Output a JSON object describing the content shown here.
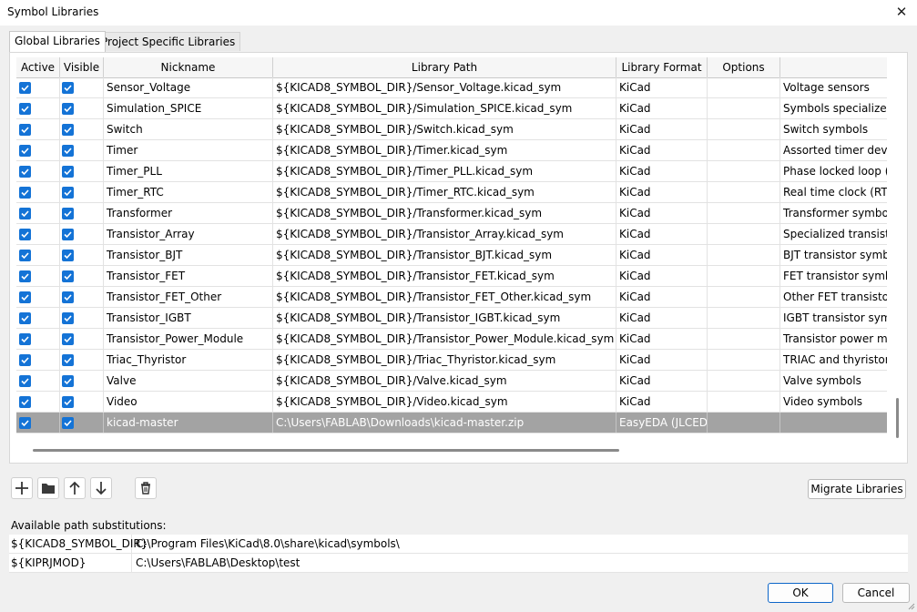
{
  "window": {
    "title": "Symbol Libraries",
    "close_glyph": "✕"
  },
  "tabs": [
    {
      "label": "Global Libraries",
      "active": true
    },
    {
      "label": "Project Specific Libraries",
      "active": false
    }
  ],
  "columns": [
    "Active",
    "Visible",
    "Nickname",
    "Library Path",
    "Library Format",
    "Options",
    ""
  ],
  "rows": [
    {
      "active": true,
      "visible": true,
      "nickname": "Sensor_Voltage",
      "path": "${KICAD8_SYMBOL_DIR}/Sensor_Voltage.kicad_sym",
      "format": "KiCad",
      "options": "",
      "description": "Voltage sensors"
    },
    {
      "active": true,
      "visible": true,
      "nickname": "Simulation_SPICE",
      "path": "${KICAD8_SYMBOL_DIR}/Simulation_SPICE.kicad_sym",
      "format": "KiCad",
      "options": "",
      "description": "Symbols specialized fo"
    },
    {
      "active": true,
      "visible": true,
      "nickname": "Switch",
      "path": "${KICAD8_SYMBOL_DIR}/Switch.kicad_sym",
      "format": "KiCad",
      "options": "",
      "description": "Switch symbols"
    },
    {
      "active": true,
      "visible": true,
      "nickname": "Timer",
      "path": "${KICAD8_SYMBOL_DIR}/Timer.kicad_sym",
      "format": "KiCad",
      "options": "",
      "description": "Assorted timer device"
    },
    {
      "active": true,
      "visible": true,
      "nickname": "Timer_PLL",
      "path": "${KICAD8_SYMBOL_DIR}/Timer_PLL.kicad_sym",
      "format": "KiCad",
      "options": "",
      "description": "Phase locked loop (PL"
    },
    {
      "active": true,
      "visible": true,
      "nickname": "Timer_RTC",
      "path": "${KICAD8_SYMBOL_DIR}/Timer_RTC.kicad_sym",
      "format": "KiCad",
      "options": "",
      "description": "Real time clock (RTC)"
    },
    {
      "active": true,
      "visible": true,
      "nickname": "Transformer",
      "path": "${KICAD8_SYMBOL_DIR}/Transformer.kicad_sym",
      "format": "KiCad",
      "options": "",
      "description": "Transformer symbols"
    },
    {
      "active": true,
      "visible": true,
      "nickname": "Transistor_Array",
      "path": "${KICAD8_SYMBOL_DIR}/Transistor_Array.kicad_sym",
      "format": "KiCad",
      "options": "",
      "description": "Specialized transistor"
    },
    {
      "active": true,
      "visible": true,
      "nickname": "Transistor_BJT",
      "path": "${KICAD8_SYMBOL_DIR}/Transistor_BJT.kicad_sym",
      "format": "KiCad",
      "options": "",
      "description": "BJT transistor symbols"
    },
    {
      "active": true,
      "visible": true,
      "nickname": "Transistor_FET",
      "path": "${KICAD8_SYMBOL_DIR}/Transistor_FET.kicad_sym",
      "format": "KiCad",
      "options": "",
      "description": "FET transistor symbols"
    },
    {
      "active": true,
      "visible": true,
      "nickname": "Transistor_FET_Other",
      "path": "${KICAD8_SYMBOL_DIR}/Transistor_FET_Other.kicad_sym",
      "format": "KiCad",
      "options": "",
      "description": "Other FET transistor sy"
    },
    {
      "active": true,
      "visible": true,
      "nickname": "Transistor_IGBT",
      "path": "${KICAD8_SYMBOL_DIR}/Transistor_IGBT.kicad_sym",
      "format": "KiCad",
      "options": "",
      "description": "IGBT transistor symbo"
    },
    {
      "active": true,
      "visible": true,
      "nickname": "Transistor_Power_Module",
      "path": "${KICAD8_SYMBOL_DIR}/Transistor_Power_Module.kicad_sym",
      "format": "KiCad",
      "options": "",
      "description": "Transistor power mod"
    },
    {
      "active": true,
      "visible": true,
      "nickname": "Triac_Thyristor",
      "path": "${KICAD8_SYMBOL_DIR}/Triac_Thyristor.kicad_sym",
      "format": "KiCad",
      "options": "",
      "description": "TRIAC and thyristor sy"
    },
    {
      "active": true,
      "visible": true,
      "nickname": "Valve",
      "path": "${KICAD8_SYMBOL_DIR}/Valve.kicad_sym",
      "format": "KiCad",
      "options": "",
      "description": "Valve symbols"
    },
    {
      "active": true,
      "visible": true,
      "nickname": "Video",
      "path": "${KICAD8_SYMBOL_DIR}/Video.kicad_sym",
      "format": "KiCad",
      "options": "",
      "description": "Video symbols"
    },
    {
      "active": true,
      "visible": true,
      "nickname": "kicad-master",
      "path": "C:\\Users\\FABLAB\\Downloads\\kicad-master.zip",
      "format": "EasyEDA (JLCEDA)",
      "options": "",
      "description": "",
      "selected": true
    }
  ],
  "toolbar": {
    "add_icon": "plus-icon",
    "folder_icon": "folder-icon",
    "up_icon": "arrow-up-icon",
    "down_icon": "arrow-down-icon",
    "delete_icon": "trash-icon",
    "migrate_label": "Migrate Libraries"
  },
  "substitutions": {
    "label": "Available path substitutions:",
    "items": [
      {
        "name": "${KICAD8_SYMBOL_DIR}",
        "value": "C:\\Program Files\\KiCad\\8.0\\share\\kicad\\symbols\\"
      },
      {
        "name": "${KIPRJMOD}",
        "value": "C:\\Users\\FABLAB\\Desktop\\test"
      }
    ]
  },
  "footer": {
    "ok_label": "OK",
    "cancel_label": "Cancel"
  },
  "colors": {
    "checkbox": "#1473d6",
    "selected_row": "#a3a3a3",
    "primary_border": "#0d66c8"
  }
}
